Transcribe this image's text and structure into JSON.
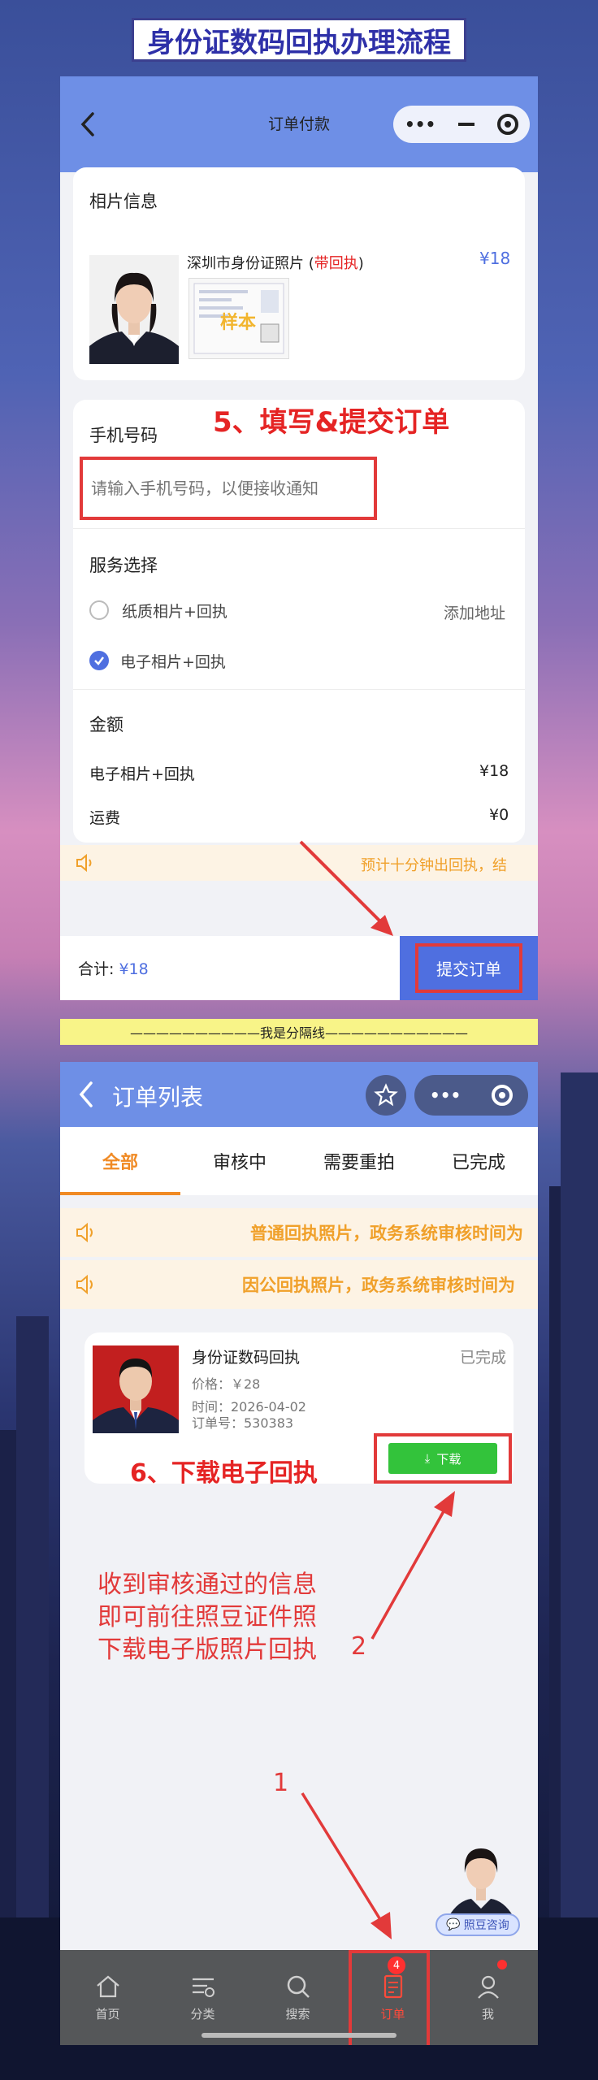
{
  "banner_title": "身份证数码回执办理流程",
  "screen1": {
    "nav_title": "订单付款",
    "photo_section_title": "相片信息",
    "product_name": "深圳市身份证照片",
    "product_tag_open": " (",
    "product_tag": "带回执",
    "product_tag_close": ")",
    "product_price": "¥18",
    "sample_watermark": "样本",
    "step5_annotation": "5、填写&提交订单",
    "phone_label": "手机号码",
    "phone_placeholder": "请输入手机号码，以便接收通知",
    "service_label": "服务选择",
    "service_options": [
      {
        "label": "纸质相片+回执",
        "selected": false
      },
      {
        "label": "电子相片+回执",
        "selected": true
      }
    ],
    "add_address": "添加地址",
    "amount_label": "金额",
    "amount_rows": [
      {
        "label": "电子相片+回执",
        "value": "¥18"
      },
      {
        "label": "运费",
        "value": "¥0"
      }
    ],
    "notice_text": "预计十分钟出回执，结",
    "total_label": "合计:",
    "total_value": "¥18",
    "submit_label": "提交订单"
  },
  "divider_text": "——————————我是分隔线———————————",
  "screen2": {
    "nav_title": "订单列表",
    "tabs": [
      {
        "label": "全部",
        "active": true
      },
      {
        "label": "审核中",
        "active": false
      },
      {
        "label": "需要重拍",
        "active": false
      },
      {
        "label": "已完成",
        "active": false
      }
    ],
    "notices": [
      "普通回执照片，政务系统审核时间为",
      "因公回执照片，政务系统审核时间为"
    ],
    "order": {
      "title": "身份证数码回执",
      "status": "已完成",
      "price": "价格：￥28",
      "time": "时间：2026-04-02",
      "order_no": "订单号：530383",
      "download_label": "下载"
    },
    "step6_annotation": "6、下载电子回执",
    "info_lines": [
      "收到审核通过的信息",
      "即可前往照豆证件照",
      "下载电子版照片回执"
    ],
    "marker_2": "2",
    "marker_1": "1",
    "consult_label": "照豆咨询",
    "bottom_tabs": [
      {
        "label": "首页",
        "icon": "home-icon"
      },
      {
        "label": "分类",
        "icon": "category-icon"
      },
      {
        "label": "搜索",
        "icon": "search-icon"
      },
      {
        "label": "订单",
        "icon": "order-icon",
        "badge": "4",
        "active": true
      },
      {
        "label": "我",
        "icon": "profile-icon"
      }
    ]
  },
  "colors": {
    "accent": "#6e8fe6",
    "annotation_red": "#e23a3a",
    "active_tab": "#f08a24",
    "download_green": "#33c33b"
  }
}
